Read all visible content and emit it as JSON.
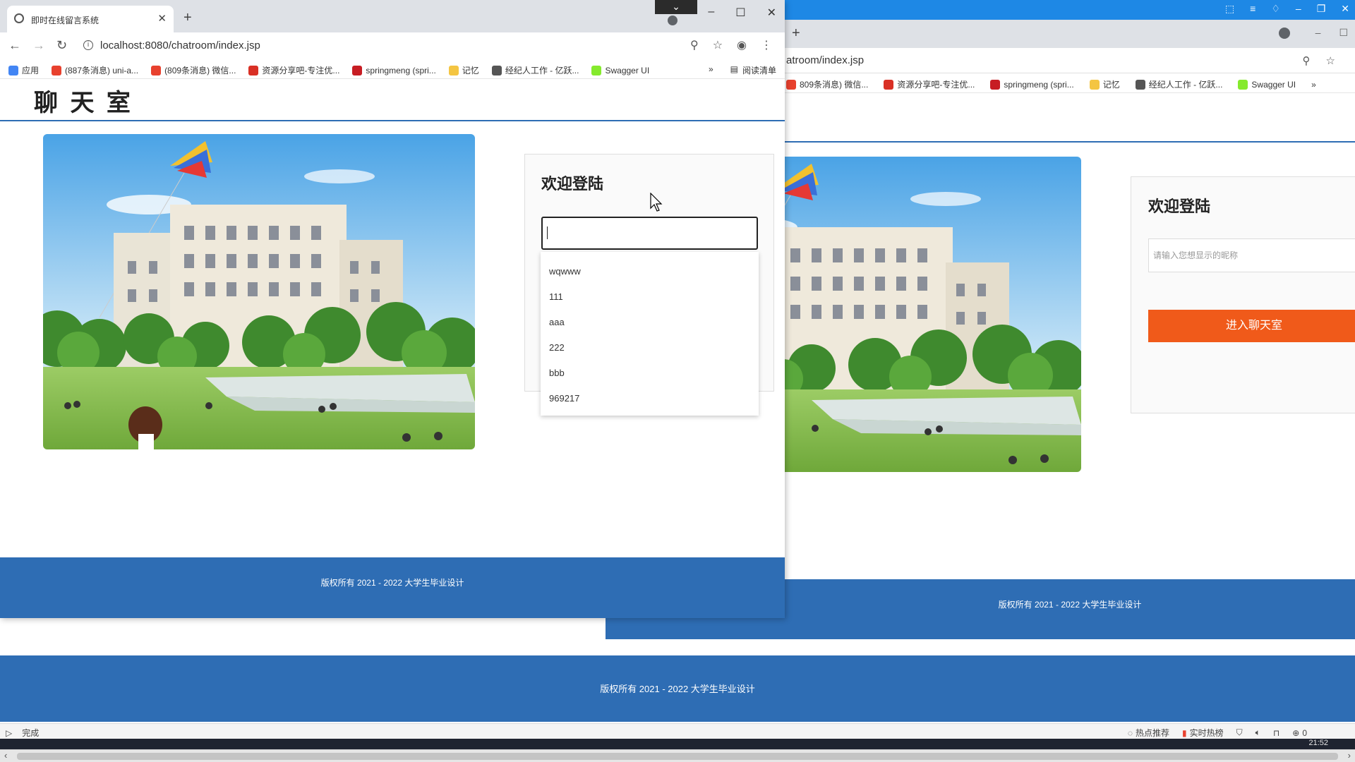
{
  "front_window": {
    "tab_title": "即时在线留言系统",
    "url": "localhost:8080/chatroom/index.jsp",
    "bookmarks": [
      {
        "label": "应用",
        "icon": "apps-grid-icon",
        "color": "#4285f4"
      },
      {
        "label": "(887条消息) uni-a...",
        "icon": "csdn-icon",
        "color": "#e8412e"
      },
      {
        "label": "(809条消息) 微信...",
        "icon": "csdn-icon",
        "color": "#e8412e"
      },
      {
        "label": "资源分享吧-专注优...",
        "icon": "share-site-icon",
        "color": "#d93025"
      },
      {
        "label": "springmeng (spri...",
        "icon": "gitee-icon",
        "color": "#c71d23"
      },
      {
        "label": "记忆",
        "icon": "folder-icon",
        "color": "#f4c542"
      },
      {
        "label": "经纪人工作 - 亿跃...",
        "icon": "agent-icon",
        "color": "#555555"
      },
      {
        "label": "Swagger UI",
        "icon": "swagger-icon",
        "color": "#85ea2d"
      }
    ],
    "bookmarks_overflow": "»",
    "reading_list": "阅读清单",
    "page": {
      "logo": "聊 天 室",
      "login_title": "欢迎登陆",
      "nickname_value": "",
      "autocomplete_options": [
        "wqwww",
        "111",
        "aaa",
        "222",
        "bbb",
        "969217"
      ],
      "footer": "版权所有 2021 - 2022 大学生毕业设计"
    }
  },
  "back_window": {
    "url": "atroom/index.jsp",
    "bookmarks": [
      {
        "label": "809条消息) 微信...",
        "icon": "csdn-icon",
        "color": "#e8412e"
      },
      {
        "label": "资源分享吧-专注优...",
        "icon": "share-site-icon",
        "color": "#d93025"
      },
      {
        "label": "springmeng (spri...",
        "icon": "gitee-icon",
        "color": "#c71d23"
      },
      {
        "label": "记忆",
        "icon": "folder-icon",
        "color": "#f4c542"
      },
      {
        "label": "经纪人工作 - 亿跃...",
        "icon": "agent-icon",
        "color": "#555555"
      },
      {
        "label": "Swagger UI",
        "icon": "swagger-icon",
        "color": "#85ea2d"
      }
    ],
    "bookmarks_overflow": "»",
    "page": {
      "login_title": "欢迎登陆",
      "nickname_placeholder": "请输入您想显示的昵称",
      "enter_button": "进入聊天室",
      "footer": "版权所有 2021 - 2022 大学生毕业设计"
    }
  },
  "background_footer": "版权所有 2021 - 2022 大学生毕业设计",
  "status_bar": {
    "status": "完成",
    "hot_recommend": "热点推荐",
    "realtime_hot": "实时热榜",
    "download_count": "0"
  },
  "taskbar": {
    "clock": "21:52"
  },
  "colors": {
    "brand_blue": "#2e6db4",
    "enter_button": "#f05a1a",
    "titlebar_blue": "#1e88e5"
  }
}
